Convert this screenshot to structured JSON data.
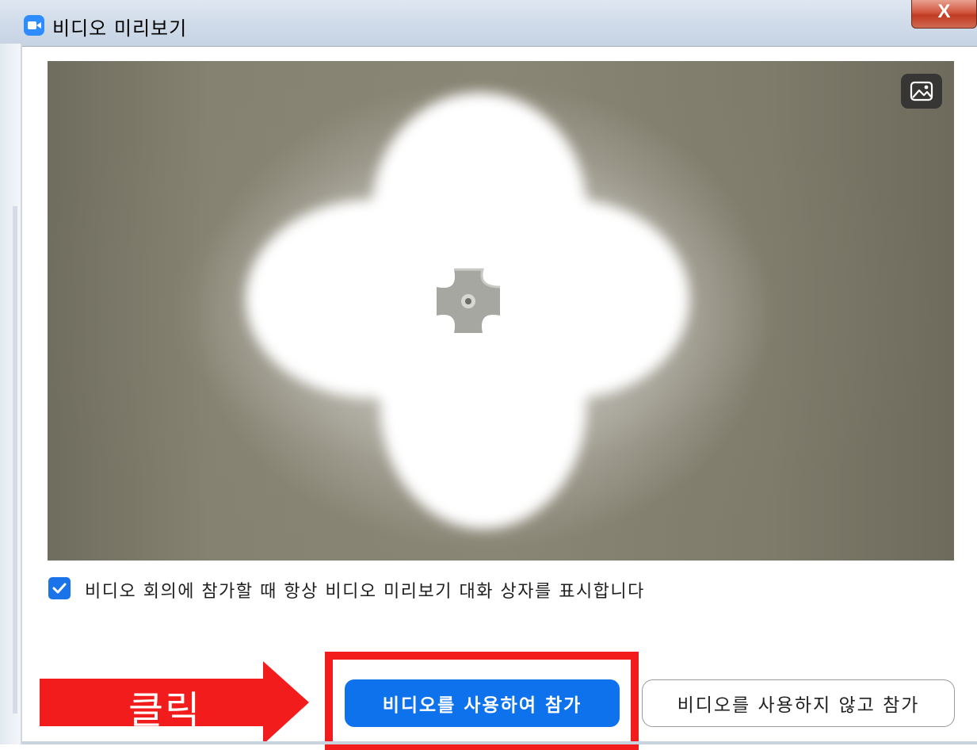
{
  "window": {
    "title": "비디오 미리보기",
    "close_label": "X",
    "app_icon": "zoom-camera-icon"
  },
  "video_preview": {
    "background_icon": "image-icon"
  },
  "options": {
    "always_show_preview_checked": true,
    "always_show_preview_label": "비디오 회의에 참가할 때 항상 비디오 미리보기 대화 상자를 표시합니다"
  },
  "annotation": {
    "arrow_label": "클릭",
    "arrow_color": "#f21c1c",
    "highlight_color": "#f21c1c"
  },
  "actions": {
    "join_with_video_label": "비디오를 사용하여 참가",
    "join_without_video_label": "비디오를 사용하지 않고 참가"
  },
  "colors": {
    "accent": "#0e72ed",
    "checkbox": "#1a73e8",
    "zoom_brand": "#2d8cff",
    "close_button": "#c23a22"
  }
}
